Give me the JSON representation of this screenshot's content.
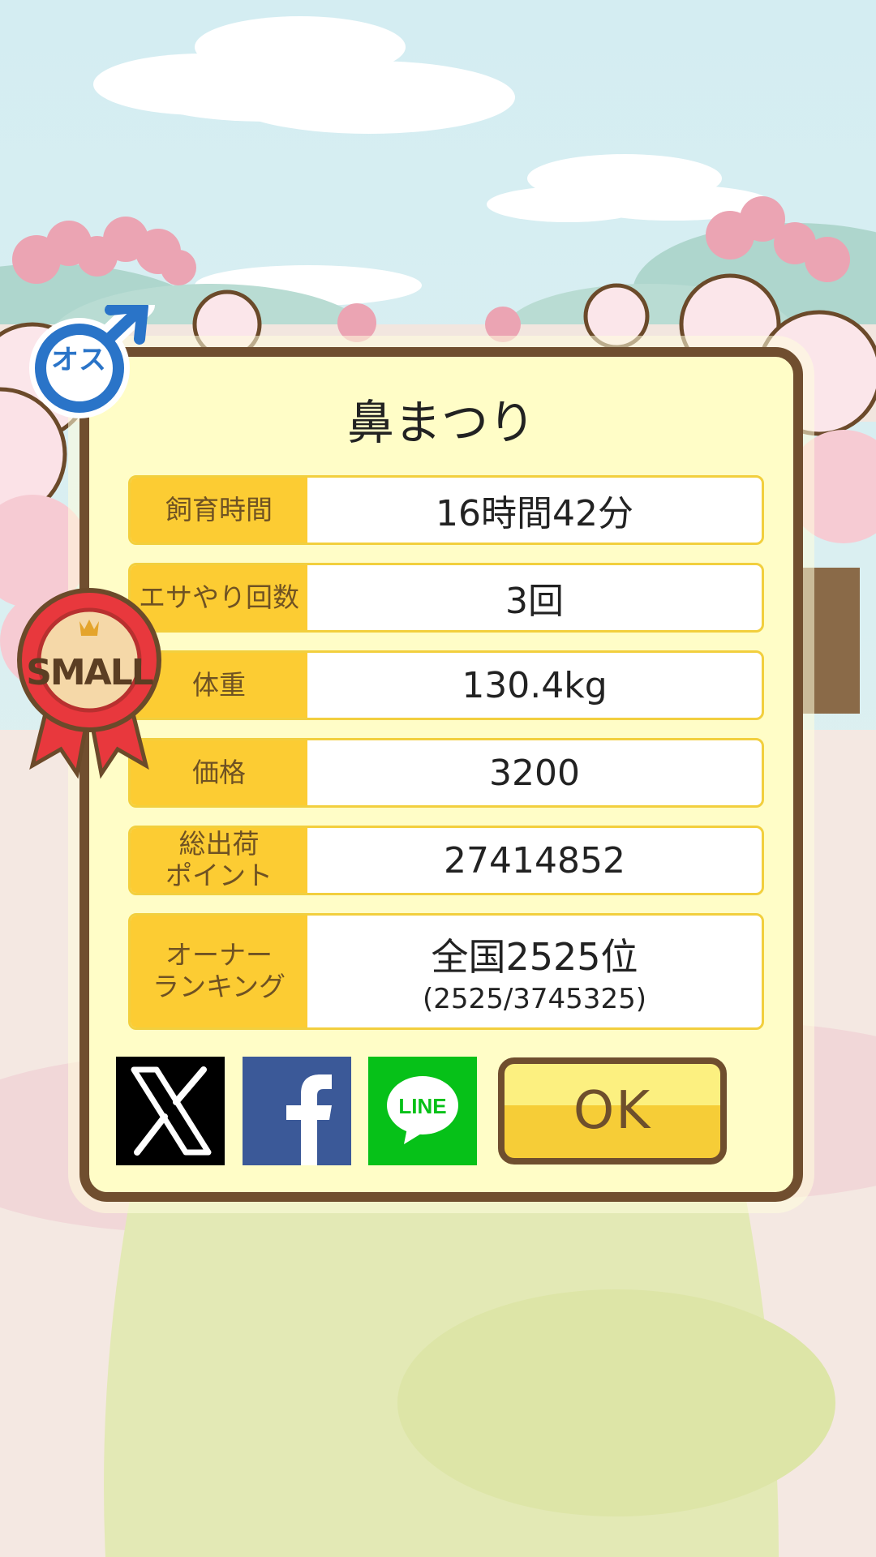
{
  "profile": {
    "name": "鼻まつり",
    "gender_label": "オス",
    "size_badge": "SMALL"
  },
  "stats": [
    {
      "label": "飼育時間",
      "value": "16時間42分"
    },
    {
      "label": "エサやり回数",
      "value": "3回"
    },
    {
      "label": "体重",
      "value": "130.4kg"
    },
    {
      "label": "価格",
      "value": "3200"
    },
    {
      "label": "総出荷\nポイント",
      "value": "27414852"
    }
  ],
  "ranking": {
    "label": "オーナー\nランキング",
    "value": "全国2525位",
    "detail": "(2525/3745325)"
  },
  "share": {
    "x_icon": "x-logo-icon",
    "facebook_icon": "facebook-logo-icon",
    "line_icon": "line-logo-icon",
    "line_text": "LINE"
  },
  "ok_label": "OK",
  "colors": {
    "card_bg": "#fffdc7",
    "card_border": "#704e2f",
    "label_bg": "#fccc33",
    "ok_top": "#fcf080",
    "ok_bottom": "#f6cd37",
    "facebook": "#3b5998",
    "line": "#06c118",
    "male_blue": "#2a74c8",
    "ribbon_red": "#e8383d"
  }
}
